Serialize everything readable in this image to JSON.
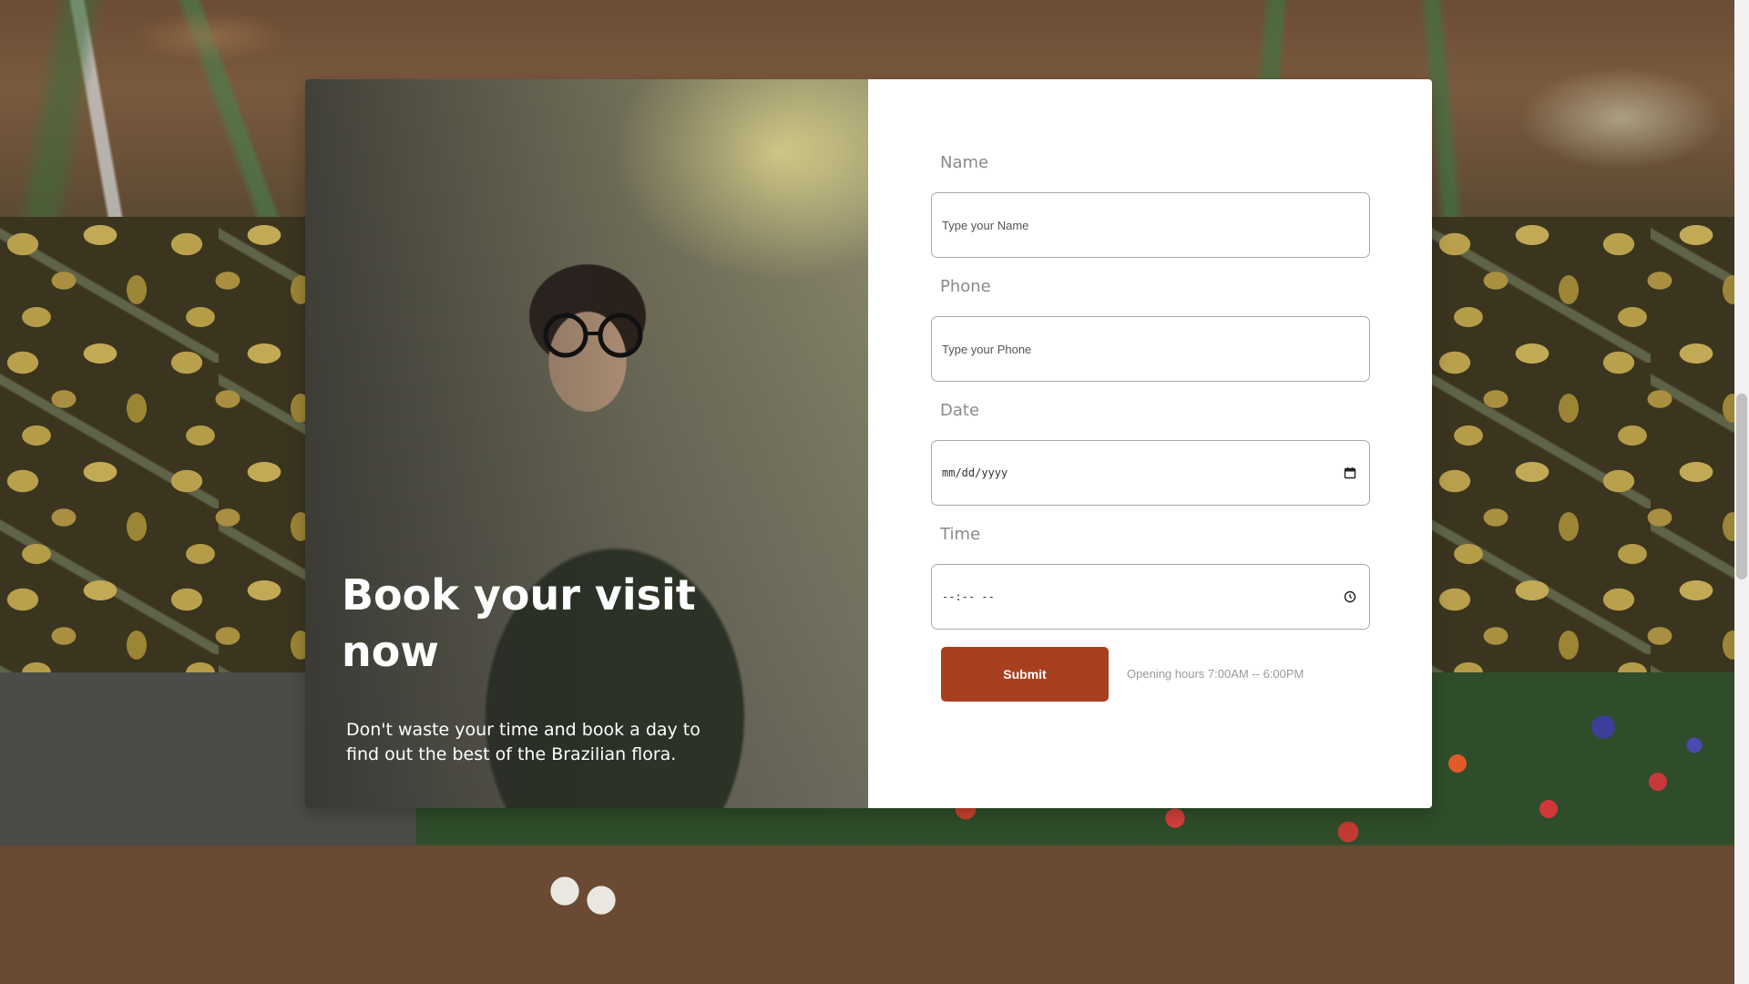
{
  "hero": {
    "title": "Book your visit now",
    "subtitle": "Don't waste your time and book a day to find out the best of the Brazilian flora."
  },
  "form": {
    "name": {
      "label": "Name",
      "placeholder": "Type your Name"
    },
    "phone": {
      "label": "Phone",
      "placeholder": "Type your Phone"
    },
    "date": {
      "label": "Date",
      "value": "mm/dd/yyyy",
      "icon": "calendar-icon"
    },
    "time": {
      "label": "Time",
      "value": "--:-- --",
      "icon": "clock-icon"
    },
    "submit_label": "Submit",
    "opening_hours": "Opening hours 7:00AM -- 6:00PM"
  },
  "colors": {
    "submit": "#a8401f",
    "label": "#8a8a8a",
    "border": "#a9a9a9"
  }
}
